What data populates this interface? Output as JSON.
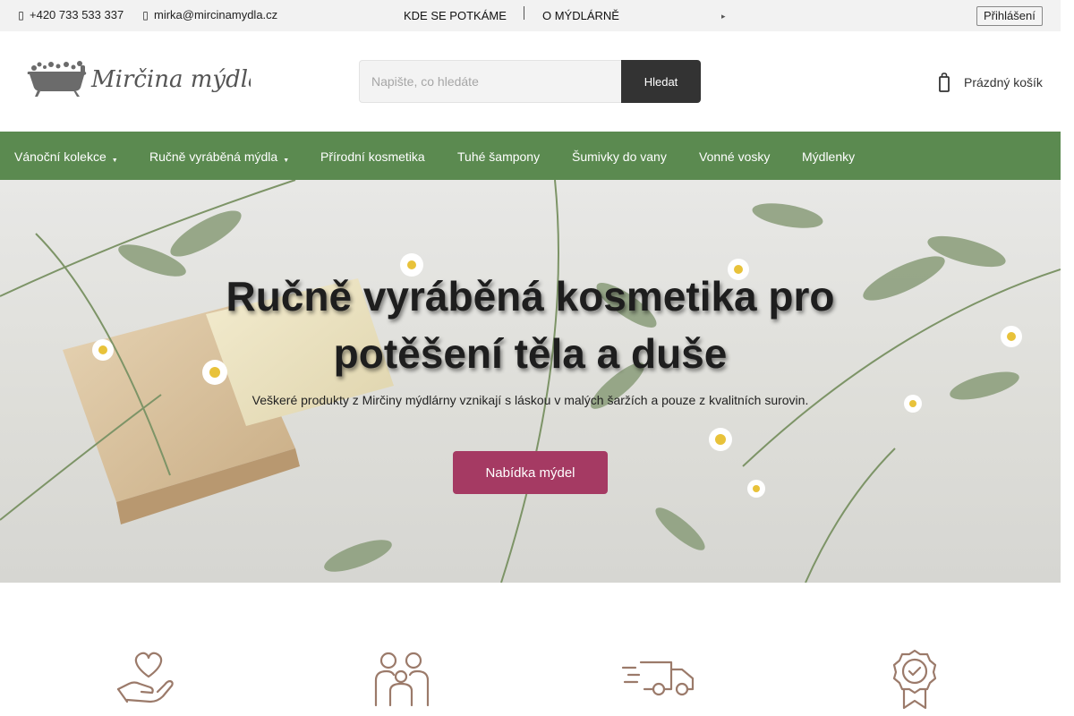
{
  "topbar": {
    "phone": "+420 733 533 337",
    "email": "mirka@mircinamydla.cz",
    "links": [
      "KDE SE POTKÁME",
      "O MÝDLÁRNĚ"
    ],
    "login": "Přihlášení"
  },
  "header": {
    "logo_text": "Mirčina mýdla",
    "search_placeholder": "Napište, co hledáte",
    "search_button": "Hledat",
    "cart_label": "Prázdný košík"
  },
  "nav": {
    "items": [
      {
        "label": "Vánoční kolekce"
      },
      {
        "label": "Ručně vyráběná mýdla"
      },
      {
        "label": "Přírodní kosmetika"
      },
      {
        "label": "Tuhé šampony"
      },
      {
        "label": "Šumivky do vany"
      },
      {
        "label": "Vonné vosky"
      },
      {
        "label": "Mýdlenky"
      }
    ]
  },
  "hero": {
    "title_line1": "Ručně vyráběná kosmetika pro",
    "title_line2": "potěšení těla a duše",
    "subtitle": "Veškeré produkty z Mirčiny mýdlárny vznikají s láskou v malých šaržích a pouze z kvalitních surovin.",
    "button": "Nabídka mýdel"
  },
  "features": {
    "icons": [
      "hand-heart-icon",
      "family-icon",
      "delivery-truck-icon",
      "quality-badge-icon"
    ]
  },
  "colors": {
    "nav_green": "#5b8a50",
    "accent_pink": "#a53a63",
    "icon_brown": "#9b7a6a"
  }
}
